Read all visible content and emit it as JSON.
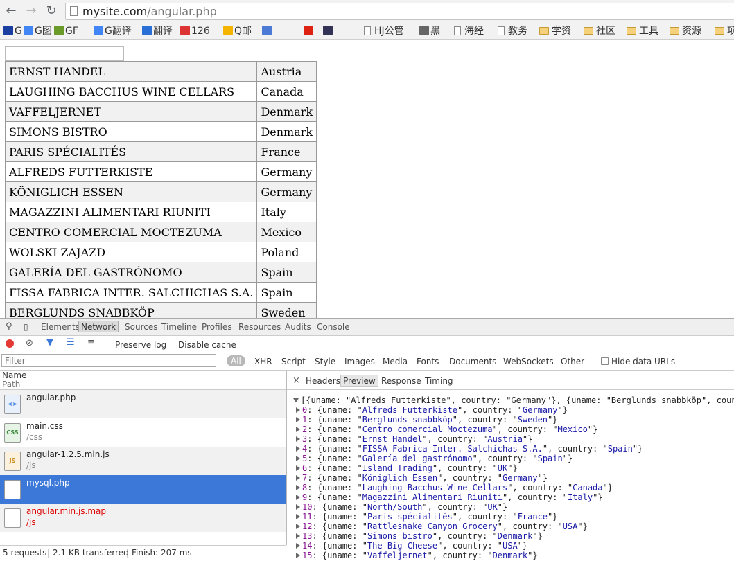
{
  "browser": {
    "url_host": "mysite.com",
    "url_path": "/angular.php",
    "bookmarks": [
      {
        "label": "G",
        "icon": "paw-icon"
      },
      {
        "label": "G图",
        "icon": "google-icon"
      },
      {
        "label": "GF",
        "icon": "gf-icon"
      },
      {
        "label": "G翻译",
        "icon": "translate-icon"
      },
      {
        "label": "翻译",
        "icon": "dictionary-icon"
      },
      {
        "label": "126",
        "icon": "mail-126-icon"
      },
      {
        "label": "Q邮",
        "icon": "qq-mail-icon"
      },
      {
        "label": "",
        "icon": "globe-icon"
      },
      {
        "label": "",
        "icon": "c-icon"
      },
      {
        "label": "",
        "icon": "g-icon"
      },
      {
        "label": "HJ公管",
        "icon": "page-icon"
      },
      {
        "label": "黑",
        "icon": "clock-icon"
      },
      {
        "label": "海经",
        "icon": "page-icon"
      },
      {
        "label": "教务",
        "icon": "page-icon"
      },
      {
        "label": "学资",
        "icon": "folder-icon"
      },
      {
        "label": "社区",
        "icon": "folder-icon"
      },
      {
        "label": "工具",
        "icon": "folder-icon"
      },
      {
        "label": "资源",
        "icon": "folder-icon"
      },
      {
        "label": "项",
        "icon": "folder-icon"
      }
    ]
  },
  "page": {
    "filter_value": "",
    "customers": [
      {
        "name": "ERNST HANDEL",
        "country": "Austria"
      },
      {
        "name": "LAUGHING BACCHUS WINE CELLARS",
        "country": "Canada"
      },
      {
        "name": "VAFFELJERNET",
        "country": "Denmark"
      },
      {
        "name": "SIMONS BISTRO",
        "country": "Denmark"
      },
      {
        "name": "PARIS SPÉCIALITÉS",
        "country": "France"
      },
      {
        "name": "ALFREDS FUTTERKISTE",
        "country": "Germany"
      },
      {
        "name": "KÖNIGLICH ESSEN",
        "country": "Germany"
      },
      {
        "name": "MAGAZZINI ALIMENTARI RIUNITI",
        "country": "Italy"
      },
      {
        "name": "CENTRO COMERCIAL MOCTEZUMA",
        "country": "Mexico"
      },
      {
        "name": "WOLSKI ZAJAZD",
        "country": "Poland"
      },
      {
        "name": "GALERÍA DEL GASTRÓNOMO",
        "country": "Spain"
      },
      {
        "name": "FISSA FABRICA INTER. SALCHICHAS S.A.",
        "country": "Spain"
      },
      {
        "name": "BERGLUNDS SNABBKÖP",
        "country": "Sweden"
      }
    ]
  },
  "devtools": {
    "tabs": [
      "Elements",
      "Network",
      "Sources",
      "Timeline",
      "Profiles",
      "Resources",
      "Audits",
      "Console"
    ],
    "active_tab": "Network",
    "preserve_log": "Preserve log",
    "disable_cache": "Disable cache",
    "filter_placeholder": "Filter",
    "types": [
      "All",
      "XHR",
      "Script",
      "Style",
      "Images",
      "Media",
      "Fonts",
      "Documents",
      "WebSockets",
      "Other"
    ],
    "hide_data_urls": "Hide data URLs",
    "col_name": "Name",
    "col_path": "Path",
    "requests": [
      {
        "name": "angular.php",
        "path": "",
        "icon": "html-file-icon",
        "icon_text": "<>"
      },
      {
        "name": "main.css",
        "path": "/css",
        "icon": "css-file-icon",
        "icon_text": "CSS"
      },
      {
        "name": "angular-1.2.5.min.js",
        "path": "/js",
        "icon": "js-file-icon",
        "icon_text": "JS"
      },
      {
        "name": "mysql.php",
        "path": "",
        "icon": "blank-file-icon",
        "icon_text": ""
      },
      {
        "name": "angular.min.js.map",
        "path": "/js",
        "icon": "blank-file-icon",
        "icon_text": ""
      }
    ],
    "status": {
      "requests": "5 requests",
      "transferred": "2.1 KB transferred",
      "finish": "Finish: 207 ms"
    },
    "preview_tabs": [
      "Headers",
      "Preview",
      "Response",
      "Timing"
    ],
    "active_preview_tab": "Preview",
    "preview_summary": "[{uname: \"Alfreds Futterkiste\", country: \"Germany\"}, {uname: \"Berglunds snabbköp\", coun",
    "preview_items": [
      {
        "index": "0",
        "uname": "Alfreds Futterkiste",
        "country": "Germany"
      },
      {
        "index": "1",
        "uname": "Berglunds snabbköp",
        "country": "Sweden"
      },
      {
        "index": "2",
        "uname": "Centro comercial Moctezuma",
        "country": "Mexico"
      },
      {
        "index": "3",
        "uname": "Ernst Handel",
        "country": "Austria"
      },
      {
        "index": "4",
        "uname": "FISSA Fabrica Inter. Salchichas S.A.",
        "country": "Spain"
      },
      {
        "index": "5",
        "uname": "Galería del gastrónomo",
        "country": "Spain"
      },
      {
        "index": "6",
        "uname": "Island Trading",
        "country": "UK"
      },
      {
        "index": "7",
        "uname": "Königlich Essen",
        "country": "Germany"
      },
      {
        "index": "8",
        "uname": "Laughing Bacchus Wine Cellars",
        "country": "Canada"
      },
      {
        "index": "9",
        "uname": "Magazzini Alimentari Riuniti",
        "country": "Italy"
      },
      {
        "index": "10",
        "uname": "North/South",
        "country": "UK"
      },
      {
        "index": "11",
        "uname": "Paris spécialités",
        "country": "France"
      },
      {
        "index": "12",
        "uname": "Rattlesnake Canyon Grocery",
        "country": "USA"
      },
      {
        "index": "13",
        "uname": "Simons bistro",
        "country": "Denmark"
      },
      {
        "index": "14",
        "uname": "The Big Cheese",
        "country": "USA"
      },
      {
        "index": "15",
        "uname": "Vaffeljernet",
        "country": "Denmark"
      }
    ]
  },
  "colors": {
    "selected_row": "#3b78d8",
    "error_text": "#dd0000",
    "record_button": "#e53935"
  }
}
